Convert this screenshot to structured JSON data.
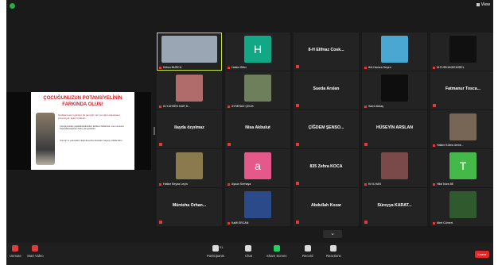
{
  "topbar": {
    "view_label": "View"
  },
  "shared_slide": {
    "title_line1": "ÇOCUĞUNUZUN POTANSİYELİNİN",
    "title_line2": "FARKINDA OLUN!",
    "subtitle": "Güdülenmenin görülen ilk gerçeği: Her çocuğun kapasitesi, potansiyeli, ilgileri farklıdır.",
    "bullets": [
      "Çocuğunuzdan yapabileceklerinden fazlasını beklemek, onun sonucun başarabileceğinden fazla yük getirebilir.",
      "Onu ilgi ve yetenekleri doğrultusunda destekler, başarıyı ödüllendirin."
    ]
  },
  "participants": [
    {
      "name": "",
      "label": "Kübra BURCU",
      "type": "video",
      "color": "#9aa6b4",
      "active": true
    },
    {
      "name": "",
      "label": "Hatice Bilici",
      "type": "letter",
      "letter": "H",
      "color": "#12a886"
    },
    {
      "name": "8-H Elifnaz Cosk...",
      "label": "",
      "type": "name"
    },
    {
      "name": "",
      "label": "8/A Hamza Seçen",
      "type": "image",
      "color": "#4aa7d1"
    },
    {
      "name": "",
      "label": "M.FURKANDEMIREL",
      "type": "image",
      "color": "#101010"
    },
    {
      "name": "",
      "label": "8-H AHSEN NUR D...",
      "type": "image",
      "color": "#b06b6b"
    },
    {
      "name": "",
      "label": "AYSENAZ ÇELİK",
      "type": "image",
      "color": "#6e7f5b"
    },
    {
      "name": "Sueda Arslan",
      "label": "",
      "type": "name"
    },
    {
      "name": "",
      "label": "Sami Akbaş",
      "type": "image",
      "color": "#0e0e0e"
    },
    {
      "name": "Fatmanur Tosca...",
      "label": "",
      "type": "name"
    },
    {
      "name": "Ilayda özyılmaz",
      "label": "",
      "type": "name"
    },
    {
      "name": "Nisa Akbulut",
      "label": "",
      "type": "name"
    },
    {
      "name": "ÇİĞDEM ŞENSO...",
      "label": "",
      "type": "name"
    },
    {
      "name": "HÜSEYİN ARSLAN",
      "label": "",
      "type": "name"
    },
    {
      "name": "",
      "label": "Hatice Kübra demir...",
      "type": "image",
      "color": "#776655"
    },
    {
      "name": "",
      "label": "Hatice Beyza Leçin",
      "type": "image",
      "color": "#8a7a4e"
    },
    {
      "name": "",
      "label": "Aysun Serhaya",
      "type": "letter",
      "letter": "a",
      "color": "#e4588a"
    },
    {
      "name": "835 Zehra KOCA",
      "label": "",
      "type": "name"
    },
    {
      "name": "",
      "label": "Kri İLHAN",
      "type": "image",
      "color": "#7a4a4a"
    },
    {
      "name": "",
      "label": "Hilal Nurs 8E",
      "type": "letter",
      "letter": "T",
      "color": "#45b84a"
    },
    {
      "name": "Münteha Orhan...",
      "label": "",
      "type": "name"
    },
    {
      "name": "",
      "label": "Kalifi ERCAN",
      "type": "image",
      "color": "#2a4a8a"
    },
    {
      "name": "Abdullah Kozar",
      "label": "",
      "type": "name"
    },
    {
      "name": "Süreyya KARAT...",
      "label": "",
      "type": "name"
    },
    {
      "name": "",
      "label": "Mert Cömert",
      "type": "image",
      "color": "#2e5a2e"
    }
  ],
  "toolbar": {
    "unmute": "Unmute",
    "start_video": "Start Video",
    "participants": "Participants",
    "participants_count": "51",
    "chat": "Chat",
    "share_screen": "Share Screen",
    "record": "Record",
    "reactions": "Reactions",
    "end": "Leave"
  }
}
